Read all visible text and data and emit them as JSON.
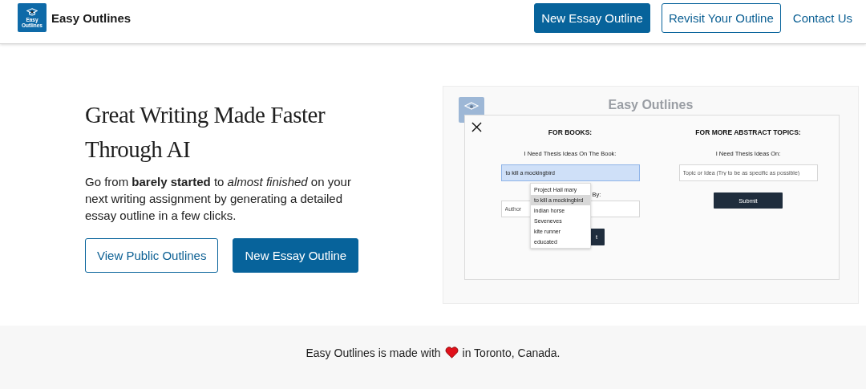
{
  "header": {
    "logo_text": [
      "Easy",
      "Outlines"
    ],
    "brand": "Easy Outlines",
    "nav": [
      {
        "label": "New Essay Outline",
        "kind": "primary"
      },
      {
        "label": "Revisit Your Outline",
        "kind": "outline"
      },
      {
        "label": "Contact Us",
        "kind": "link"
      }
    ]
  },
  "hero": {
    "title_lines": [
      "Great Writing Made Faster",
      "Through AI"
    ],
    "description": "Go from **barely started** to *almost finished* on your next writing assignment by generating a detailed essay outline in a few clicks.",
    "buttons": [
      {
        "label": "View Public Outlines",
        "kind": "outline"
      },
      {
        "label": "New Essay Outline",
        "kind": "primary"
      }
    ]
  },
  "preview": {
    "title": "Easy Outlines",
    "books": {
      "heading": "FOR BOOKS:",
      "label": "I Need Thesis Ideas On The Book:",
      "value": "to kill a mockingbird",
      "author_label": "By:",
      "author_placeholder": "Author",
      "submit": "t",
      "suggestions": [
        {
          "label": "Project Hail mary",
          "selected": false
        },
        {
          "label": "to kill a mockingbird",
          "selected": true
        },
        {
          "label": "indian horse",
          "selected": false
        },
        {
          "label": "Seveneves",
          "selected": false
        },
        {
          "label": "kite runner",
          "selected": false
        },
        {
          "label": "educated",
          "selected": false
        }
      ]
    },
    "topics": {
      "heading": "FOR MORE ABSTRACT TOPICS:",
      "label": "I Need Thesis Ideas On:",
      "placeholder": "Topic or Idea (Try to be as specific as possible)",
      "submit": "Submit"
    }
  },
  "footer": {
    "before": "Easy Outlines is made with",
    "after": "in Toronto, Canada."
  }
}
